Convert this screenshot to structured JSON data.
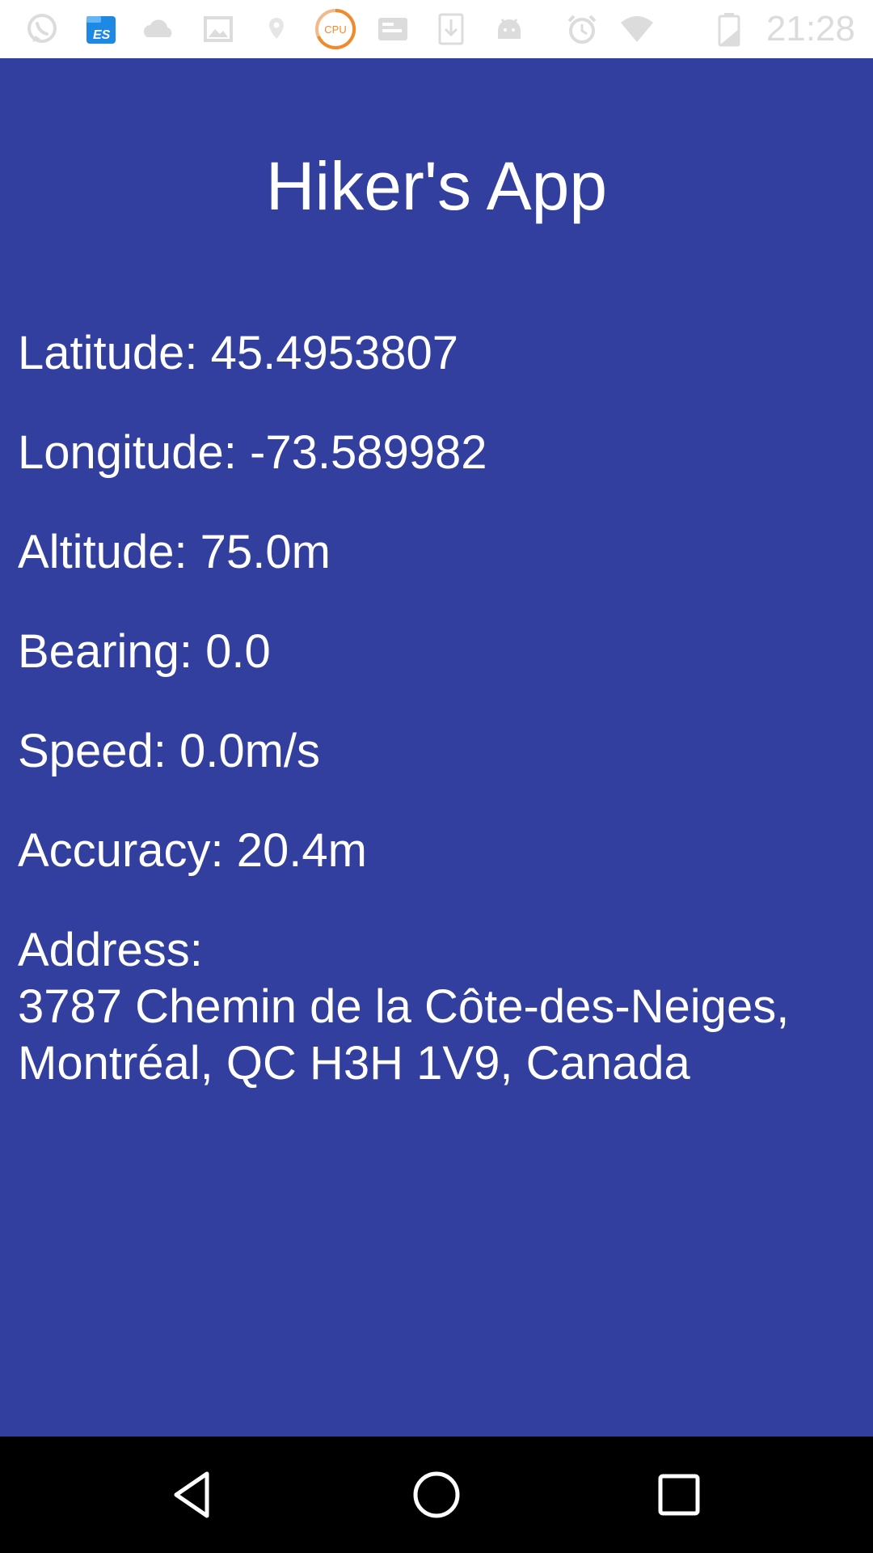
{
  "status_bar": {
    "time": "21:28",
    "icons": [
      "whatsapp-icon",
      "es-file-explorer-icon",
      "cloud-icon",
      "image-icon",
      "location-icon",
      "cpu-monitor-icon",
      "message-icon",
      "download-icon",
      "android-icon",
      "alarm-icon",
      "wifi-icon",
      "battery-icon"
    ],
    "cpu_label": "CPU"
  },
  "app": {
    "title": "Hiker's App",
    "latitude": "Latitude: 45.4953807",
    "longitude": "Longitude: -73.589982",
    "altitude": "Altitude: 75.0m",
    "bearing": "Bearing: 0.0",
    "speed": "Speed: 0.0m/s",
    "accuracy": "Accuracy: 20.4m",
    "address_label": "Address:",
    "address_line1": "3787 Chemin de la Côte-des-Neiges,",
    "address_line2": "Montréal, QC H3H 1V9, Canada"
  },
  "nav_bar": {
    "buttons": [
      "back-icon",
      "home-icon",
      "recents-icon"
    ]
  },
  "colors": {
    "background": "#323f9e",
    "text": "#ffffff",
    "status_bar": "#ffffff",
    "nav_bar": "#000000",
    "cpu_accent": "#f08a2a",
    "es_accent": "#1e88e5"
  }
}
